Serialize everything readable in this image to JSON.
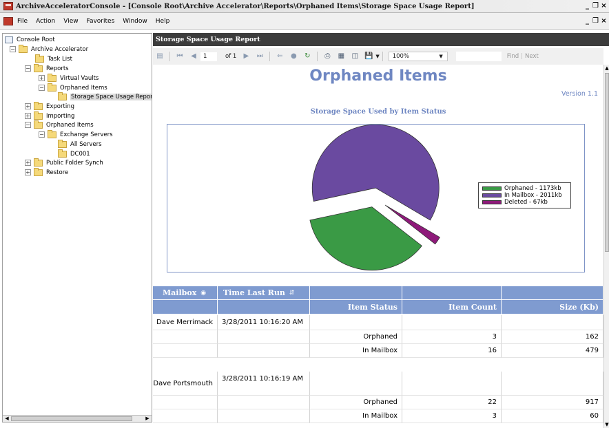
{
  "window": {
    "title": "ArchiveAcceleratorConsole - [Console Root\\Archive Accelerator\\Reports\\Orphaned Items\\Storage Space Usage Report]",
    "controls": [
      "_",
      "❒",
      "×"
    ]
  },
  "menu": {
    "items": [
      "File",
      "Action",
      "View",
      "Favorites",
      "Window",
      "Help"
    ]
  },
  "tree": {
    "nodes": [
      {
        "label": "Console Root",
        "expander": ""
      },
      {
        "label": "Archive Accelerator",
        "expander": "−"
      },
      {
        "label": "Task List",
        "expander": ""
      },
      {
        "label": "Reports",
        "expander": "−"
      },
      {
        "label": "Virtual Vaults",
        "expander": "+"
      },
      {
        "label": "Orphaned Items",
        "expander": "−"
      },
      {
        "label": "Storage Space Usage Repor",
        "expander": ""
      },
      {
        "label": "Exporting",
        "expander": "+"
      },
      {
        "label": "Importing",
        "expander": "+"
      },
      {
        "label": "Orphaned Items",
        "expander": "−"
      },
      {
        "label": "Exchange Servers",
        "expander": "−"
      },
      {
        "label": "All Servers",
        "expander": ""
      },
      {
        "label": "DC001",
        "expander": ""
      },
      {
        "label": "Public Folder Synch",
        "expander": "+"
      },
      {
        "label": "Restore",
        "expander": "+"
      }
    ]
  },
  "panel": {
    "header": "Storage Space Usage Report"
  },
  "toolbar": {
    "page_current": "1",
    "page_of": "of 1",
    "zoom": "100%",
    "find_label": "Find",
    "next_label": "Next"
  },
  "report": {
    "title": "Orphaned Items",
    "version": "Version 1.1",
    "chart_title": "Storage Space Used by Item Status"
  },
  "chart_data": {
    "type": "pie",
    "title": "Storage Space Used by Item Status",
    "slices": [
      {
        "label": "Orphaned - 1173kb",
        "value": 1173,
        "color": "#3a9a45"
      },
      {
        "label": "In Mailbox - 2011kb",
        "value": 2011,
        "color": "#6a4aa0"
      },
      {
        "label": "Deleted - 67kb",
        "value": 67,
        "color": "#8e1a7a"
      }
    ],
    "legend_position": "right"
  },
  "table": {
    "headers": {
      "mailbox": "Mailbox",
      "time_last_run": "Time Last Run",
      "item_status": "Item Status",
      "item_count": "Item Count",
      "size": "Size (Kb)"
    },
    "groups": [
      {
        "mailbox": "Dave Merrimack",
        "time": "3/28/2011 10:16:20 AM",
        "rows": [
          {
            "status": "Orphaned",
            "count": "3",
            "size": "162"
          },
          {
            "status": "In Mailbox",
            "count": "16",
            "size": "479"
          }
        ]
      },
      {
        "mailbox": "Dave Portsmouth",
        "time": "3/28/2011 10:16:19 AM",
        "rows": [
          {
            "status": "Orphaned",
            "count": "22",
            "size": "917"
          },
          {
            "status": "In Mailbox",
            "count": "3",
            "size": "60"
          }
        ]
      }
    ]
  }
}
